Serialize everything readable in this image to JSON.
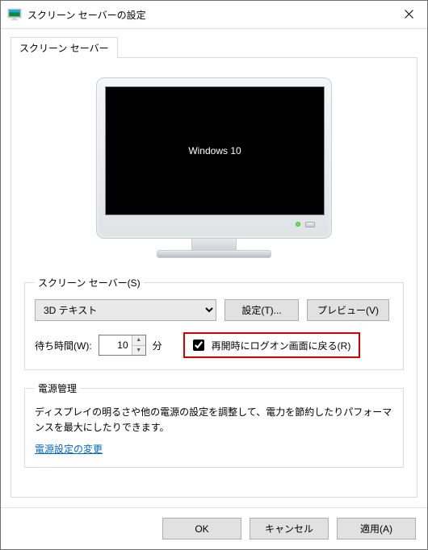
{
  "window": {
    "title": "スクリーン セーバーの設定"
  },
  "tab": {
    "label": "スクリーン セーバー"
  },
  "preview": {
    "screen_text": "Windows 10"
  },
  "ss_group": {
    "legend": "スクリーン セーバー(S)",
    "select_value": "3D テキスト",
    "settings_btn": "設定(T)...",
    "preview_btn": "プレビュー(V)",
    "wait_label": "待ち時間(W):",
    "wait_value": "10",
    "wait_unit": "分",
    "resume_label": "再開時にログオン画面に戻る(R)"
  },
  "power_group": {
    "legend": "電源管理",
    "text": "ディスプレイの明るさや他の電源の設定を調整して、電力を節約したりパフォーマンスを最大にしたりできます。",
    "link": "電源設定の変更"
  },
  "footer": {
    "ok": "OK",
    "cancel": "キャンセル",
    "apply": "適用(A)"
  }
}
